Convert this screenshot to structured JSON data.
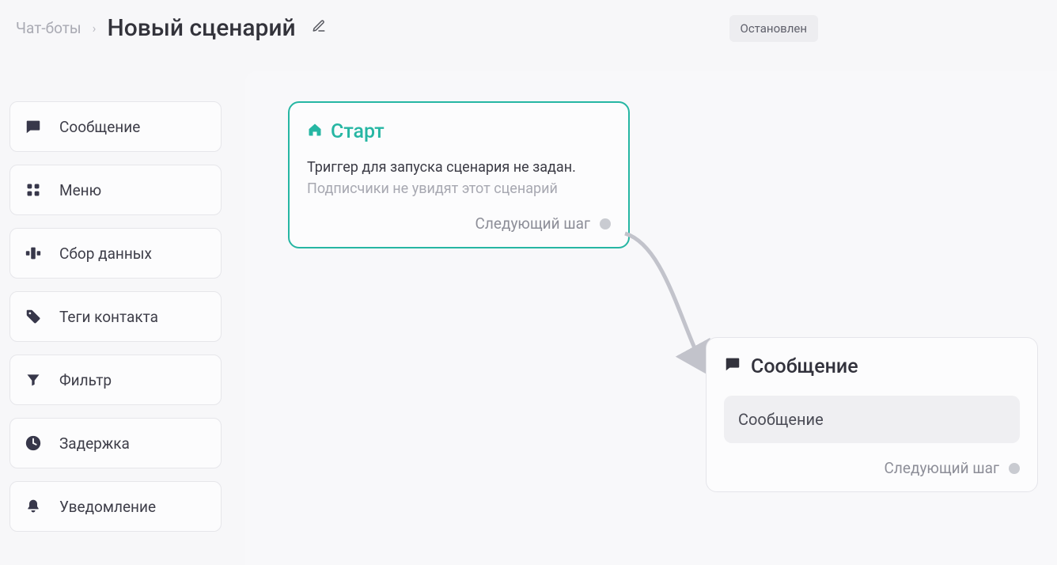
{
  "breadcrumb": {
    "root": "Чат-боты"
  },
  "page": {
    "title": "Новый сценарий"
  },
  "status": {
    "label": "Остановлен"
  },
  "palette": {
    "items": [
      {
        "label": "Сообщение"
      },
      {
        "label": "Меню"
      },
      {
        "label": "Сбор данных"
      },
      {
        "label": "Теги контакта"
      },
      {
        "label": "Фильтр"
      },
      {
        "label": "Задержка"
      },
      {
        "label": "Уведомление"
      }
    ]
  },
  "nodes": {
    "start": {
      "title": "Старт",
      "trigger_missing": "Триггер для запуска сценария не задан.",
      "trigger_sub": "Подписчики не увидят этот сценарий",
      "next_label": "Следующий шаг"
    },
    "message": {
      "title": "Сообщение",
      "body": "Сообщение",
      "next_label": "Следующий шаг"
    }
  }
}
